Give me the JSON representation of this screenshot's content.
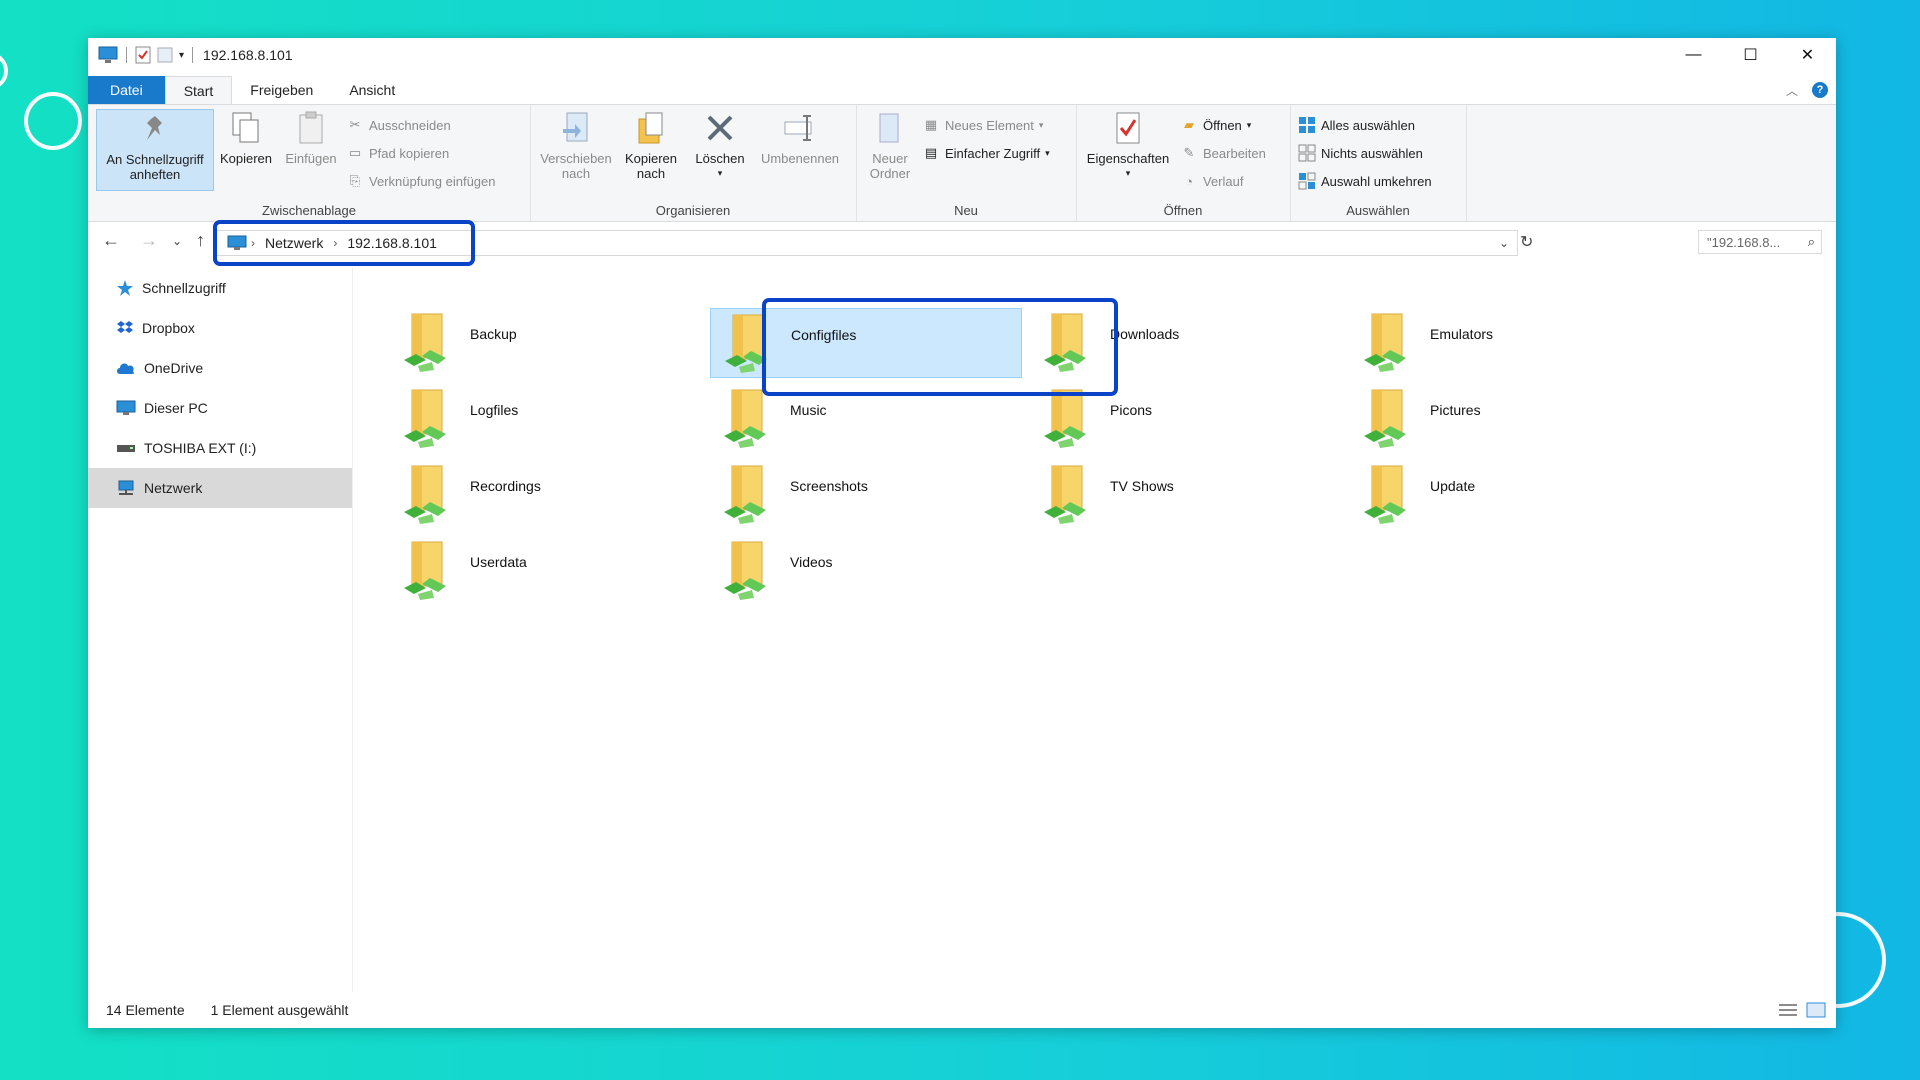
{
  "window": {
    "title": "192.168.8.101",
    "controls": {
      "minimize": "—",
      "maximize": "☐",
      "close": "✕"
    }
  },
  "tabs": [
    "Datei",
    "Start",
    "Freigeben",
    "Ansicht"
  ],
  "ribbon": {
    "clipboard": {
      "label": "Zwischenablage",
      "pin_line1": "An Schnellzugriff",
      "pin_line2": "anheften",
      "copy": "Kopieren",
      "paste": "Einfügen",
      "cut": "Ausschneiden",
      "copy_path": "Pfad kopieren",
      "paste_shortcut": "Verknüpfung einfügen"
    },
    "organize": {
      "label": "Organisieren",
      "move_line1": "Verschieben",
      "move_line2": "nach",
      "copy_line1": "Kopieren",
      "copy_line2": "nach",
      "delete": "Löschen",
      "rename": "Umbenennen"
    },
    "new": {
      "label": "Neu",
      "folder_line1": "Neuer",
      "folder_line2": "Ordner",
      "new_item": "Neues Element",
      "easy_access": "Einfacher Zugriff"
    },
    "open": {
      "label": "Öffnen",
      "properties": "Eigenschaften",
      "open": "Öffnen",
      "edit": "Bearbeiten",
      "history": "Verlauf"
    },
    "select": {
      "label": "Auswählen",
      "select_all": "Alles auswählen",
      "select_none": "Nichts auswählen",
      "invert": "Auswahl umkehren"
    }
  },
  "address": {
    "crumbs": [
      "Netzwerk",
      "192.168.8.101"
    ],
    "search_placeholder": "\"192.168.8..."
  },
  "sidebar": {
    "items": [
      "Schnellzugriff",
      "Dropbox",
      "OneDrive",
      "Dieser PC",
      "TOSHIBA EXT (I:)",
      "Netzwerk"
    ]
  },
  "folders": [
    "Backup",
    "Configfiles",
    "Downloads",
    "Emulators",
    "Logfiles",
    "Music",
    "Picons",
    "Pictures",
    "Recordings",
    "Screenshots",
    "TV Shows",
    "Update",
    "Userdata",
    "Videos"
  ],
  "status": {
    "count": "14 Elemente",
    "selected": "1 Element ausgewählt"
  },
  "colors": {
    "accent": "#1979ca",
    "highlight": "#0a43c8",
    "selection": "#cce8ff",
    "background_start": "#13e0c4",
    "background_end": "#12b7e4"
  }
}
